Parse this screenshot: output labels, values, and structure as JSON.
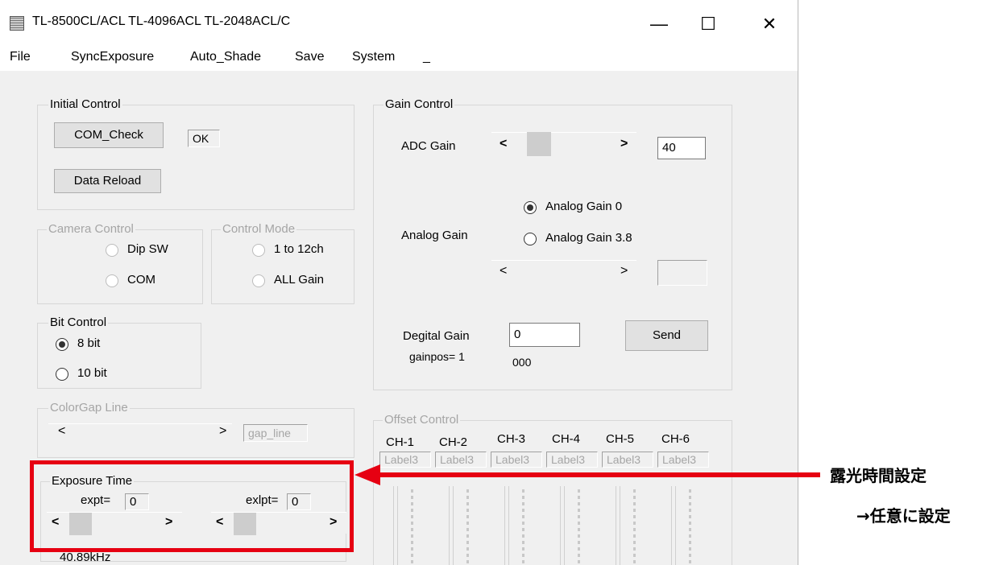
{
  "window": {
    "title": "TL-8500CL/ACL TL-4096ACL TL-2048ACL/C",
    "minimize": "—",
    "maximize": "☐",
    "close": "✕"
  },
  "menu": [
    "File",
    "SyncExposure",
    "Auto_Shade",
    "Save",
    "System",
    "_"
  ],
  "initial_control": {
    "title": "Initial Control",
    "com_check": "COM_Check",
    "status": "OK",
    "data_reload": "Data Reload"
  },
  "camera_control": {
    "title": "Camera Control",
    "options": [
      "Dip SW",
      "COM"
    ]
  },
  "control_mode": {
    "title": "Control Mode",
    "options": [
      "1 to 12ch",
      "ALL Gain"
    ]
  },
  "bit_control": {
    "title": "Bit Control",
    "options": [
      "8 bit",
      "10 bit"
    ],
    "selected": "8 bit"
  },
  "colorgap": {
    "title": "ColorGap Line",
    "value": "gap_line"
  },
  "exposure": {
    "title": "Exposure Time",
    "expt_label": "expt=",
    "expt_value": "0",
    "exlpt_label": "exlpt=",
    "exlpt_value": "0",
    "freq": "40.89kHz"
  },
  "gain_control": {
    "title": "Gain Control",
    "adc_label": "ADC Gain",
    "adc_value": "40",
    "analog_label": "Analog Gain",
    "analog_options": [
      "Analog Gain 0",
      "Analog Gain 3.8"
    ],
    "analog_selected": "Analog Gain 0",
    "digital_label": "Degital Gain",
    "digital_value": "0",
    "gainpos": "gainpos= 1",
    "digital_code": "000",
    "send": "Send"
  },
  "offset_control": {
    "title": "Offset Control",
    "channels": [
      "CH-1",
      "CH-2",
      "CH-3",
      "CH-4",
      "CH-5",
      "CH-6"
    ],
    "label": "Label3"
  },
  "annotation": {
    "line1": "露光時間設定",
    "line2": "→任意に設定",
    "color": "#e60012"
  }
}
